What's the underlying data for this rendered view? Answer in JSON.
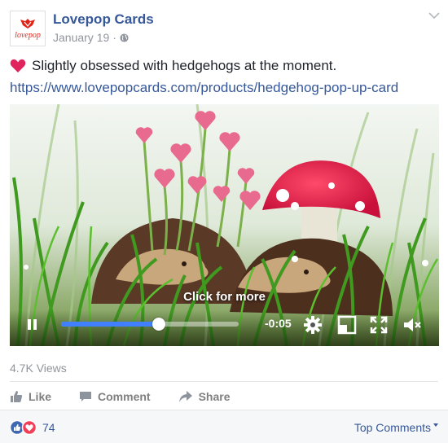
{
  "post": {
    "page_name": "Lovepop Cards",
    "avatar_text": "lovepop",
    "date": "January 19",
    "separator": "·",
    "text": "Slightly obsessed with hedgehogs at the moment.",
    "link": "https://www.lovepopcards.com/products/hedgehog-pop-up-card"
  },
  "video": {
    "click_for_more": "Click for more",
    "time_remaining": "-0:05",
    "progress": 0.55
  },
  "stats": {
    "views": "4.7K Views"
  },
  "actions": {
    "like": "Like",
    "comment": "Comment",
    "share": "Share"
  },
  "reactions": {
    "count": "74",
    "top_comments": "Top Comments"
  },
  "colors": {
    "link": "#365899",
    "muted": "#90949c",
    "progress": "#4080ff",
    "love": "#f33e58",
    "like": "#4267b2"
  }
}
